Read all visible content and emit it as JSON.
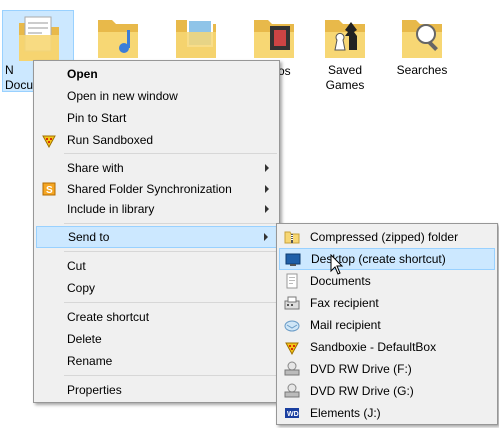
{
  "desktop": {
    "folders": [
      {
        "label": "N...\nDocu...",
        "selected": true
      },
      {
        "label": "",
        "selected": false
      },
      {
        "label": "",
        "selected": false
      },
      {
        "label": "...os",
        "selected": false
      },
      {
        "label": "Saved Games",
        "selected": false
      },
      {
        "label": "Searches",
        "selected": false
      }
    ],
    "doc_partial": "N",
    "doc_partial2": "Docu",
    "videos_partial": "os",
    "saved_games": "Saved\nGames",
    "saved_games_l1": "Saved",
    "saved_games_l2": "Games",
    "searches": "Searches"
  },
  "context_menu": {
    "open": "Open",
    "open_new_window": "Open in new window",
    "pin_to_start": "Pin to Start",
    "run_sandboxed": "Run Sandboxed",
    "share_with": "Share with",
    "shared_folder_sync": "Shared Folder Synchronization",
    "include_in_library": "Include in library",
    "send_to": "Send to",
    "cut": "Cut",
    "copy": "Copy",
    "create_shortcut": "Create shortcut",
    "delete": "Delete",
    "rename": "Rename",
    "properties": "Properties"
  },
  "send_to_menu": {
    "compressed": "Compressed (zipped) folder",
    "desktop": "Desktop (create shortcut)",
    "documents": "Documents",
    "fax": "Fax recipient",
    "mail": "Mail recipient",
    "sandboxie": "Sandboxie - DefaultBox",
    "dvd_f": "DVD RW Drive (F:)",
    "dvd_g": "DVD RW Drive (G:)",
    "elements": "Elements (J:)"
  },
  "colors": {
    "menu_bg": "#f0f0f0",
    "highlight": "#cce8ff",
    "highlight_border": "#99d1ff",
    "folder_yellow": "#f7d774"
  }
}
